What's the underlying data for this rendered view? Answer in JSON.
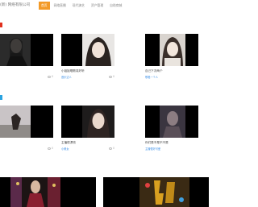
{
  "header": {
    "company": "(新) 网络有限公司",
    "nav": [
      {
        "label": "首页",
        "active": true
      },
      {
        "label": "网络直播",
        "active": false
      },
      {
        "label": "现代演艺",
        "active": false
      },
      {
        "label": "资产管理",
        "active": false
      },
      {
        "label": "自助商城",
        "active": false
      }
    ]
  },
  "section1": {
    "cards": [
      {
        "title": "",
        "meta": "",
        "count": "0"
      },
      {
        "title": "小姐姐唱歌真好听",
        "meta": "音乐达人",
        "count": "0"
      },
      {
        "title": "自己下次两个",
        "meta": "歌唱一个人",
        "count": ""
      }
    ]
  },
  "section2": {
    "cards": [
      {
        "title": "",
        "meta": "",
        "count": "0"
      },
      {
        "title": "主播很漂亮",
        "meta": "小美女",
        "count": "0"
      },
      {
        "title": "你们是不是不不是",
        "meta": "主播很好可爱",
        "count": ""
      }
    ]
  }
}
